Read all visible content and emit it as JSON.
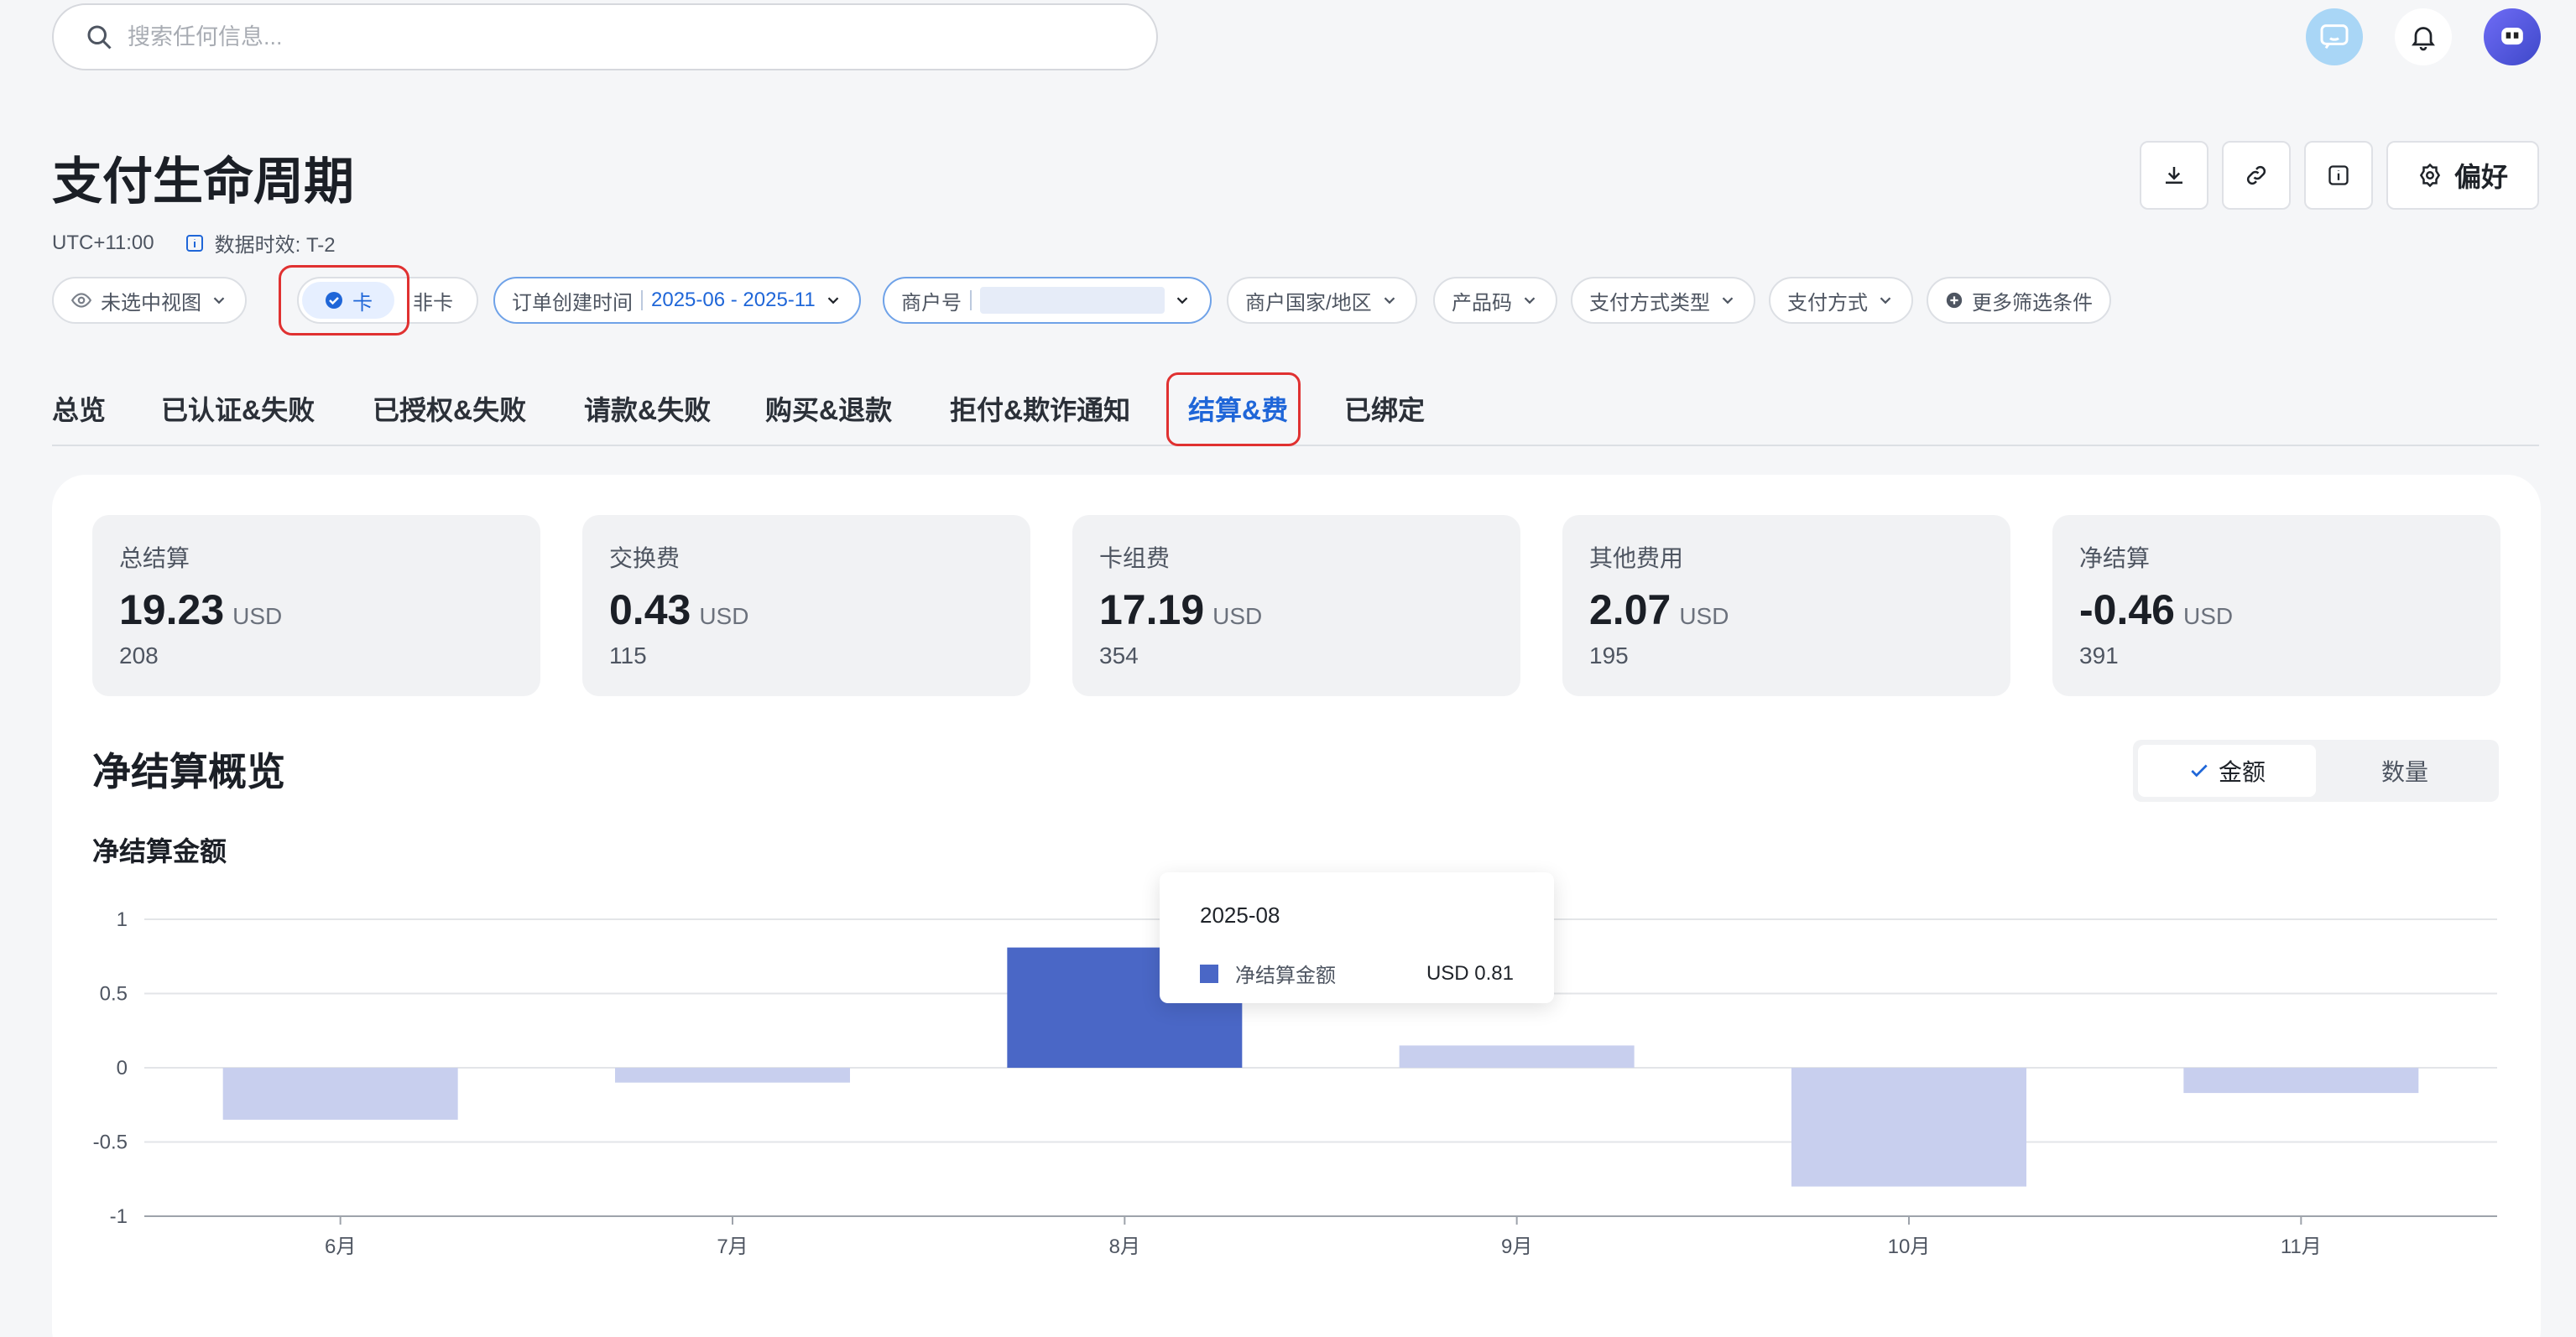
{
  "search": {
    "placeholder": "搜索任何信息..."
  },
  "header": {
    "title": "支付生命周期",
    "timezone": "UTC+11:00",
    "data_freshness": "数据时效: T-2",
    "preference_label": "偏好"
  },
  "filters": {
    "view": "未选中视图",
    "card": "卡",
    "non_card": "非卡",
    "order_time_label": "订单创建时间",
    "order_time_value": "2025-06 - 2025-11",
    "merchant_label": "商户号",
    "country": "商户国家/地区",
    "product_code": "产品码",
    "payment_method_type": "支付方式类型",
    "payment_method": "支付方式",
    "more": "更多筛选条件"
  },
  "tabs": [
    {
      "label": "总览"
    },
    {
      "label": "已认证&失败"
    },
    {
      "label": "已授权&失败"
    },
    {
      "label": "请款&失败"
    },
    {
      "label": "购买&退款"
    },
    {
      "label": "拒付&欺诈通知"
    },
    {
      "label": "结算&费"
    },
    {
      "label": "已绑定"
    }
  ],
  "stats": [
    {
      "label": "总结算",
      "value": "19.23",
      "unit": "USD",
      "count": "208"
    },
    {
      "label": "交换费",
      "value": "0.43",
      "unit": "USD",
      "count": "115"
    },
    {
      "label": "卡组费",
      "value": "17.19",
      "unit": "USD",
      "count": "354"
    },
    {
      "label": "其他费用",
      "value": "2.07",
      "unit": "USD",
      "count": "195"
    },
    {
      "label": "净结算",
      "value": "-0.46",
      "unit": "USD",
      "count": "391"
    }
  ],
  "section": {
    "title": "净结算概览",
    "toggle_amount": "金额",
    "toggle_count": "数量"
  },
  "chart_data": {
    "type": "bar",
    "title": "净结算金额",
    "categories": [
      "6月",
      "7月",
      "8月",
      "9月",
      "10月",
      "11月"
    ],
    "series": [
      {
        "name": "净结算金额",
        "values": [
          -0.35,
          -0.1,
          0.81,
          0.15,
          -0.8,
          -0.17
        ]
      }
    ],
    "ylim": [
      -1,
      1
    ],
    "yticks": [
      "1",
      "0.5",
      "0",
      "-0.5",
      "-1"
    ],
    "grid": true,
    "highlight_index": 2,
    "colors": {
      "highlight": "#4a67c6",
      "normal": "#c8cfee"
    }
  },
  "tooltip": {
    "date": "2025-08",
    "series_name": "净结算金额",
    "value": "USD 0.81"
  }
}
